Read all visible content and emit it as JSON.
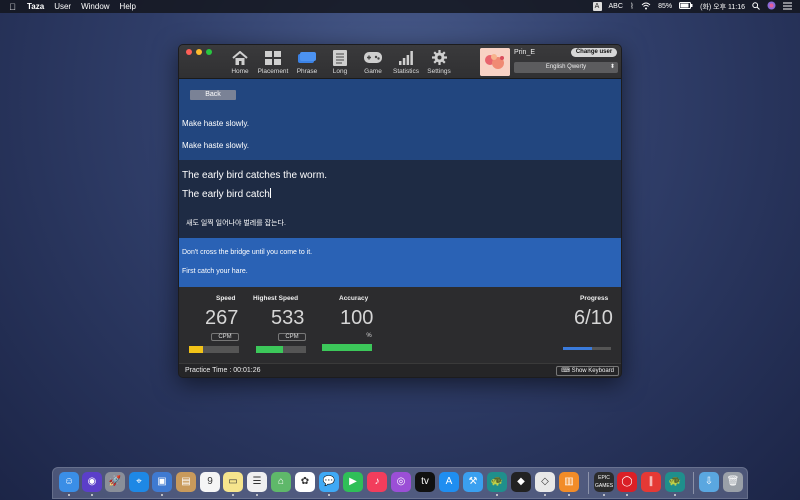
{
  "menubar": {
    "app": "Taza",
    "items": [
      "User",
      "Window",
      "Help"
    ],
    "input_badge": "A",
    "input_label": "ABC",
    "battery": "85%",
    "clock": "(화) 오후 11:16"
  },
  "toolbar": {
    "items": [
      {
        "label": "Home",
        "icon": "home-icon"
      },
      {
        "label": "Placement",
        "icon": "placement-icon"
      },
      {
        "label": "Phrase",
        "icon": "phrase-icon"
      },
      {
        "label": "Long",
        "icon": "long-icon"
      },
      {
        "label": "Game",
        "icon": "game-icon"
      },
      {
        "label": "Statistics",
        "icon": "statistics-icon"
      },
      {
        "label": "Settings",
        "icon": "settings-icon"
      }
    ],
    "username": "Prin_E",
    "change_user_label": "Change user",
    "keyboard_layout": "English Qwerty"
  },
  "practice": {
    "back_label": "Back",
    "previous_phrase": "Make haste slowly.",
    "previous_typed": "Make haste slowly.",
    "current_phrase": "The early bird catches the worm.",
    "current_typed": "The early bird catch",
    "current_translation": "새도 일찍 일어나야 벌레를 잡는다.",
    "next_phrase": "Don't cross the bridge until you come to it.",
    "next_next_phrase": "First catch your hare."
  },
  "stats": {
    "speed_label": "Speed",
    "speed_value": "267",
    "speed_unit": "CPM",
    "speed_fraction": 0.27,
    "highest_label": "Highest Speed",
    "highest_value": "533",
    "highest_unit": "CPM",
    "highest_fraction": 0.53,
    "accuracy_label": "Accuracy",
    "accuracy_value": "100",
    "accuracy_unit": "%",
    "accuracy_fraction": 1.0,
    "progress_label": "Progress",
    "progress_value": "6/10",
    "progress_fraction": 0.6
  },
  "footer": {
    "practice_time": "Practice Time : 00:01:26",
    "show_keyboard_label": "Show Keyboard"
  },
  "colors": {
    "speed_bar": "#f2c318",
    "highest_bar": "#3cc85a",
    "accuracy_bar": "#3cc85a",
    "progress_bar": "#3a7bdc"
  },
  "dock": {
    "apps": [
      "Finder",
      "Siri",
      "Launchpad",
      "Safari",
      "Preview",
      "Notes",
      "Calendar",
      "Stickies",
      "Reminders",
      "Maps",
      "Photos",
      "Messages",
      "FaceTime",
      "Music",
      "Podcasts",
      "TV",
      "App Store",
      "Xcode",
      "Taza",
      "Unity",
      "Unity Hub",
      "Books",
      "Epic Games",
      "Creative Cloud",
      "Parallels",
      "Taza Helper",
      "Downloads",
      "Trash"
    ],
    "epic_label": "EPIC GAMES"
  }
}
